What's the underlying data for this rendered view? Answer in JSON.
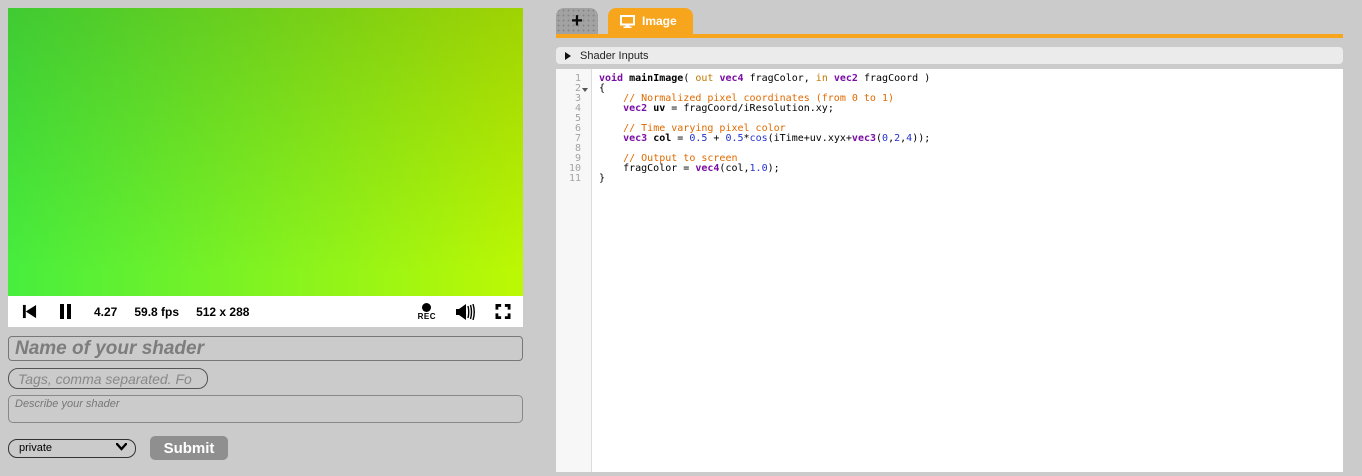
{
  "player": {
    "time": "4.27",
    "fps": "59.8 fps",
    "resolution": "512 x 288",
    "rec_label": "REC"
  },
  "form": {
    "name_placeholder": "Name of your shader",
    "tags_placeholder": "Tags, comma separated. Fo",
    "description_placeholder": "Describe your shader",
    "visibility_value": "private",
    "submit_label": "Submit"
  },
  "tabs": {
    "new_tab_label": "+",
    "image_tab_label": "Image"
  },
  "shader_inputs": {
    "label": "Shader Inputs"
  },
  "colors": {
    "accent_orange": "#f7a51c",
    "canvas_top_left": "#4acc3e",
    "canvas_top_right": "#afc31f",
    "canvas_bottom_left": "#47f23f",
    "canvas_bottom_right": "#bdf803",
    "syntax_keyword": "#7a0da6",
    "syntax_qualifier": "#c17800",
    "syntax_comment": "#e06a00",
    "syntax_number": "#2233cc"
  },
  "editor": {
    "lines": [
      {
        "n": "1",
        "fold": false,
        "tokens": [
          [
            "kw",
            "void"
          ],
          [
            "p",
            " "
          ],
          [
            "b",
            "mainImage"
          ],
          [
            "p",
            "( "
          ],
          [
            "q",
            "out"
          ],
          [
            "p",
            " "
          ],
          [
            "kw",
            "vec4"
          ],
          [
            "p",
            " fragColor, "
          ],
          [
            "q",
            "in"
          ],
          [
            "p",
            " "
          ],
          [
            "kw",
            "vec2"
          ],
          [
            "p",
            " fragCoord )"
          ]
        ]
      },
      {
        "n": "2",
        "fold": true,
        "tokens": [
          [
            "p",
            "{"
          ]
        ]
      },
      {
        "n": "3",
        "fold": false,
        "tokens": [
          [
            "p",
            "    "
          ],
          [
            "cm",
            "// Normalized pixel coordinates (from 0 to 1)"
          ]
        ]
      },
      {
        "n": "4",
        "fold": false,
        "tokens": [
          [
            "p",
            "    "
          ],
          [
            "kw",
            "vec2"
          ],
          [
            "p",
            " "
          ],
          [
            "b",
            "uv"
          ],
          [
            "p",
            " = fragCoord/iResolution.xy;"
          ]
        ]
      },
      {
        "n": "5",
        "fold": false,
        "tokens": []
      },
      {
        "n": "6",
        "fold": false,
        "tokens": [
          [
            "p",
            "    "
          ],
          [
            "cm",
            "// Time varying pixel color"
          ]
        ]
      },
      {
        "n": "7",
        "fold": false,
        "tokens": [
          [
            "p",
            "    "
          ],
          [
            "kw",
            "vec3"
          ],
          [
            "p",
            " "
          ],
          [
            "b",
            "col"
          ],
          [
            "p",
            " = "
          ],
          [
            "num",
            "0.5"
          ],
          [
            "p",
            " + "
          ],
          [
            "num",
            "0.5"
          ],
          [
            "p",
            "*"
          ],
          [
            "fn",
            "cos"
          ],
          [
            "p",
            "(iTime+uv.xyx+"
          ],
          [
            "kw",
            "vec3"
          ],
          [
            "p",
            "("
          ],
          [
            "num",
            "0"
          ],
          [
            "p",
            ","
          ],
          [
            "num",
            "2"
          ],
          [
            "p",
            ","
          ],
          [
            "num",
            "4"
          ],
          [
            "p",
            "));"
          ]
        ]
      },
      {
        "n": "8",
        "fold": false,
        "tokens": []
      },
      {
        "n": "9",
        "fold": false,
        "tokens": [
          [
            "p",
            "    "
          ],
          [
            "cm",
            "// Output to screen"
          ]
        ]
      },
      {
        "n": "10",
        "fold": false,
        "tokens": [
          [
            "p",
            "    fragColor = "
          ],
          [
            "kw",
            "vec4"
          ],
          [
            "p",
            "(col,"
          ],
          [
            "num",
            "1.0"
          ],
          [
            "p",
            ");"
          ]
        ]
      },
      {
        "n": "11",
        "fold": false,
        "tokens": [
          [
            "p",
            "}"
          ]
        ]
      }
    ]
  }
}
